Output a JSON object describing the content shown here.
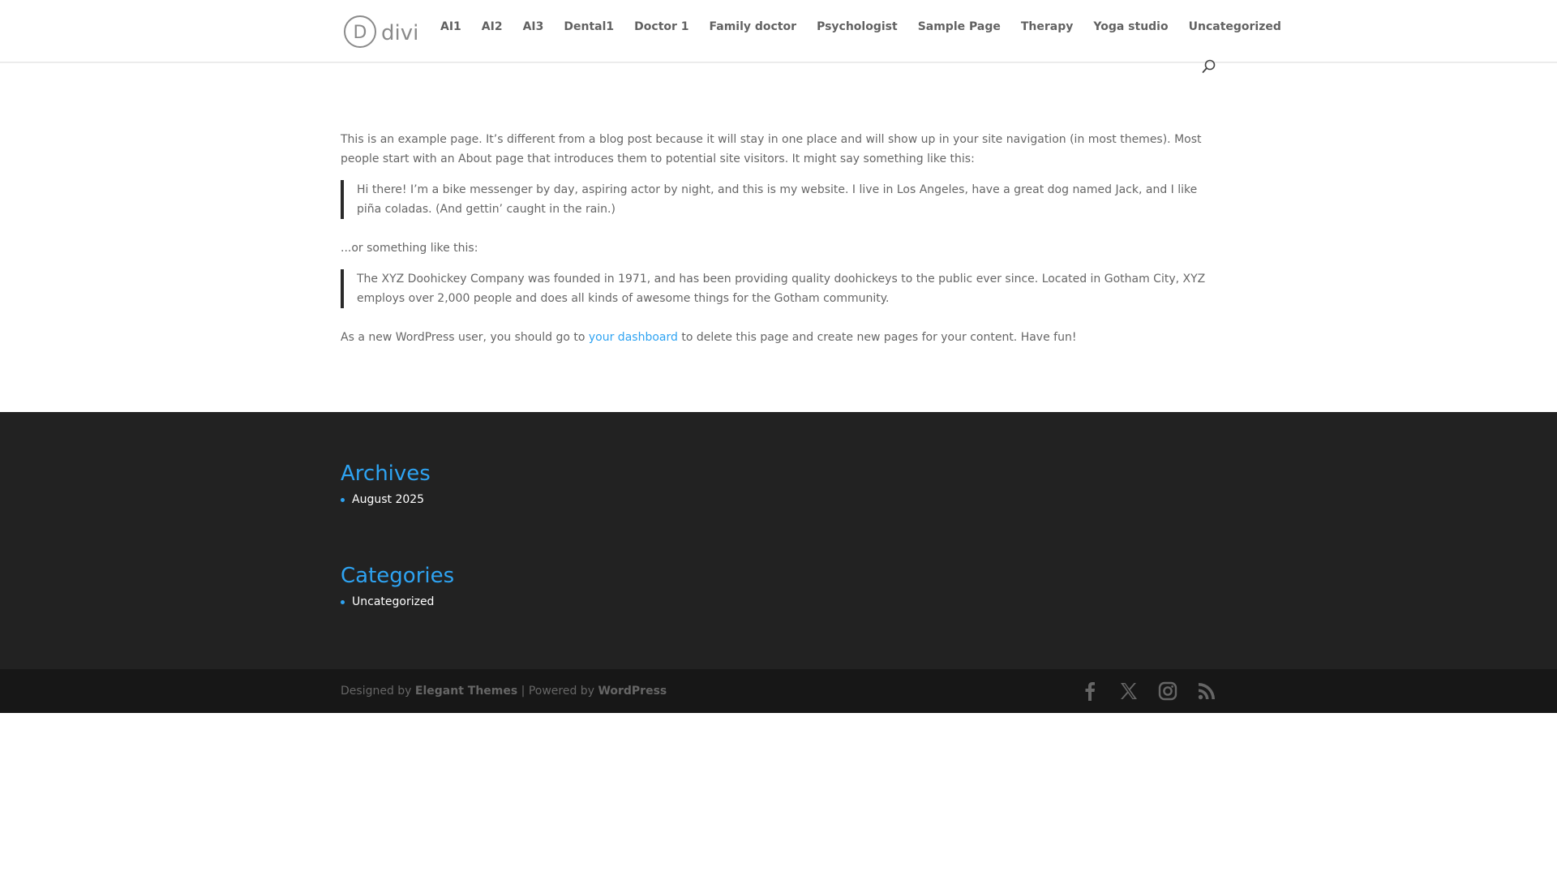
{
  "header": {
    "logo_text": "divi",
    "logo_letter": "D",
    "nav": [
      {
        "label": "AI1"
      },
      {
        "label": "AI2"
      },
      {
        "label": "AI3"
      },
      {
        "label": "Dental1"
      },
      {
        "label": "Doctor 1"
      },
      {
        "label": "Family doctor"
      },
      {
        "label": "Psychologist"
      },
      {
        "label": "Sample Page"
      },
      {
        "label": "Therapy"
      },
      {
        "label": "Yoga studio"
      },
      {
        "label": "Uncategorized"
      }
    ]
  },
  "content": {
    "intro": "This is an example page. It’s different from a blog post because it will stay in one place and will show up in your site navigation (in most themes). Most people start with an About page that introduces them to potential site visitors. It might say something like this:",
    "quote1": "Hi there! I’m a bike messenger by day, aspiring actor by night, and this is my website. I live in Los Angeles, have a great dog named Jack, and I like piña coladas. (And gettin’ caught in the rain.)",
    "or_text": "...or something like this:",
    "quote2": "The XYZ Doohickey Company was founded in 1971, and has been providing quality doohickeys to the public ever since. Located in Gotham City, XYZ employs over 2,000 people and does all kinds of awesome things for the Gotham community.",
    "closing_before": "As a new WordPress user, you should go to ",
    "closing_link": "your dashboard",
    "closing_after": " to delete this page and create new pages for your content. Have fun!"
  },
  "footer": {
    "archives": {
      "title": "Archives",
      "items": [
        "August 2025"
      ]
    },
    "categories": {
      "title": "Categories",
      "items": [
        "Uncategorized"
      ]
    }
  },
  "bottom": {
    "designed_by": "Designed by ",
    "elegant_themes": "Elegant Themes",
    "powered_by": " | Powered by ",
    "wordpress": "WordPress"
  },
  "colors": {
    "accent": "#2ea3f2",
    "footer_bg": "#222222",
    "bottom_bg": "#171717",
    "text": "#666666"
  },
  "icons": {
    "search": "search-icon",
    "facebook": "facebook-icon",
    "x": "x-icon",
    "instagram": "instagram-icon",
    "rss": "rss-icon"
  }
}
